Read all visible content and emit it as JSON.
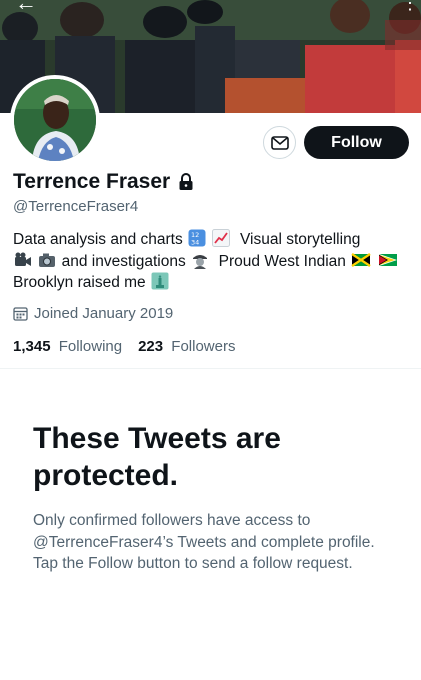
{
  "nav": {
    "back_glyph": "←",
    "more_glyph": "⋮"
  },
  "banner": {
    "description_icon": "protest-crowd-photo"
  },
  "actions": {
    "message_icon": "envelope-icon",
    "follow_label": "Follow"
  },
  "profile": {
    "display_name": "Terrence Fraser",
    "handle": "@TerrenceFraser4",
    "protected_icon": "lock-icon",
    "bio": {
      "line1_a": "Data analysis and charts",
      "line1_b": "Visual storytelling",
      "line2_a": "and investigations",
      "line2_b": "Proud West Indian",
      "line3_a": "Brooklyn raised me"
    },
    "joined": "Joined January 2019",
    "following_count": "1,345",
    "following_label": "Following",
    "followers_count": "223",
    "followers_label": "Followers"
  },
  "protected": {
    "title": "These Tweets are protected.",
    "body": "Only confirmed followers have access to @TerrenceFraser4’s Tweets and complete profile. Tap the Follow button to send a follow request."
  },
  "colors": {
    "primary_text": "#0f1419",
    "secondary_text": "#536471",
    "follow_bg": "#0f1419",
    "divider": "#eff3f4"
  }
}
